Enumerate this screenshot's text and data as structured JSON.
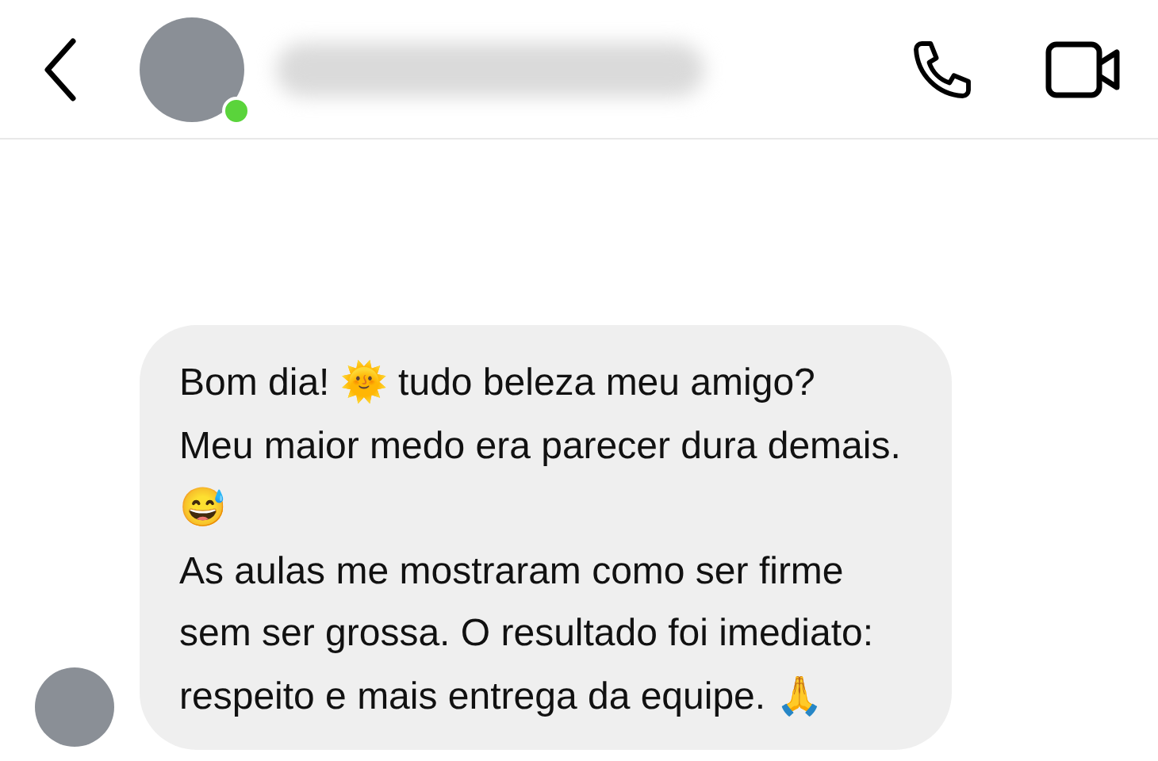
{
  "header": {
    "online": true
  },
  "messages": [
    {
      "text": "Bom dia!  🌞  tudo beleza meu amigo?\nMeu maior medo era parecer dura demais.  😅\nAs aulas me mostraram como ser firme sem ser grossa. O resultado foi imediato: respeito e mais entrega da equipe.  🙏"
    }
  ]
}
